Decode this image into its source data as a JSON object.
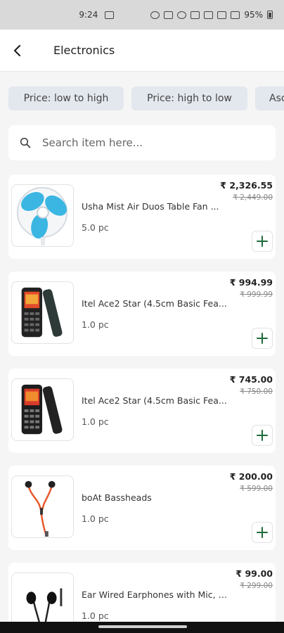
{
  "status": {
    "time": "9:24",
    "battery": "95%"
  },
  "header": {
    "title": "Electronics"
  },
  "chips": [
    "Price: low to high",
    "Price: high to low",
    "Asc"
  ],
  "search": {
    "placeholder": "Search item here..."
  },
  "products": [
    {
      "name": "Usha Mist Air Duos Table Fan ...",
      "qty": "5.0 pc",
      "price": "₹ 2,326.55",
      "mrp": "₹ 2,449.00",
      "icon": "fan-image"
    },
    {
      "name": "Itel Ace2 Star (4.5cm Basic Fea...",
      "qty": "1.0 pc",
      "price": "₹ 994.99",
      "mrp": "₹ 999.99",
      "icon": "phone-image"
    },
    {
      "name": "Itel Ace2 Star (4.5cm Basic Fea...",
      "qty": "1.0 pc",
      "price": "₹ 745.00",
      "mrp": "₹ 750.00",
      "icon": "phone-image"
    },
    {
      "name": "boAt Bassheads",
      "qty": "1.0 pc",
      "price": "₹ 200.00",
      "mrp": "₹ 599.00",
      "icon": "earphones-image"
    },
    {
      "name": "Ear Wired Earphones with Mic, 3...",
      "qty": "1.0 pc",
      "price": "₹ 99.00",
      "mrp": "₹ 299.00",
      "icon": "earphones-image"
    }
  ],
  "colors": {
    "accent": "#1f6b3a",
    "chip_bg": "#e3e7ee"
  }
}
